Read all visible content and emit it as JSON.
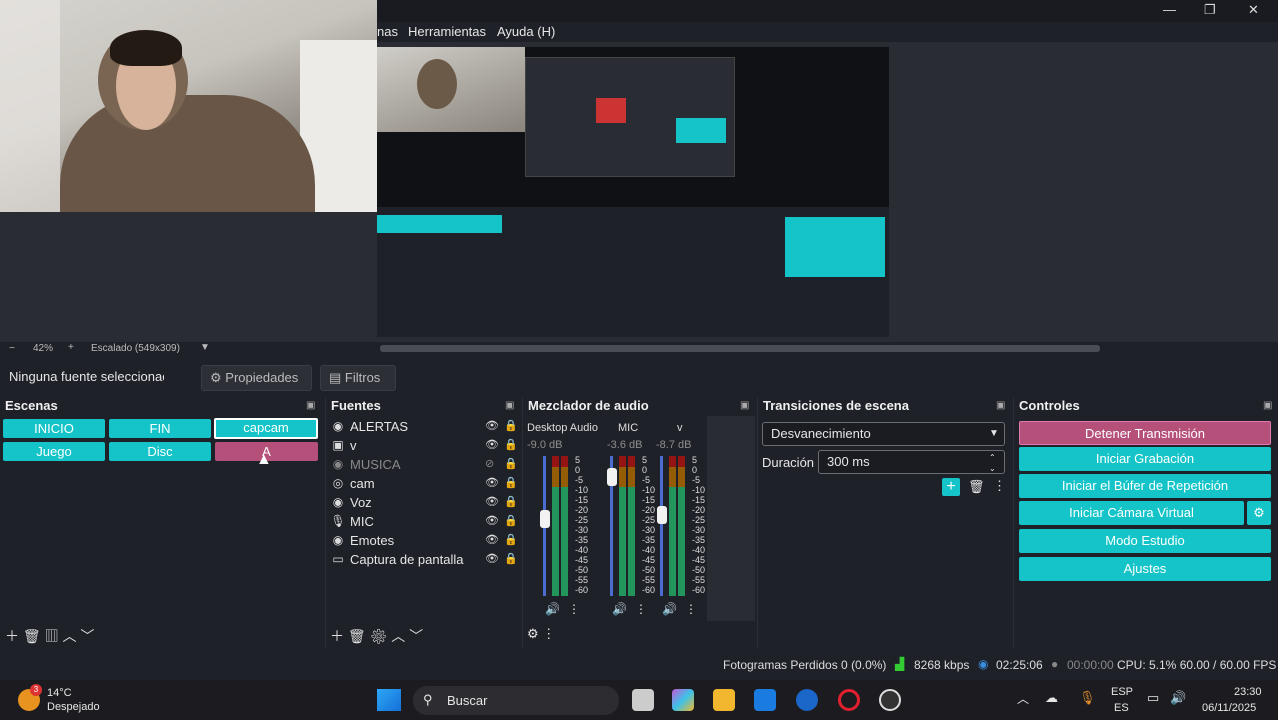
{
  "menu": {
    "partial_item": "nas",
    "items": [
      "Herramientas",
      "Ayuda (H)"
    ]
  },
  "window_controls": {
    "minimize": "—",
    "maximize": "❐",
    "close": "✕"
  },
  "preview": {
    "zoom": "42%",
    "scaling": "Escalado (549x309)"
  },
  "source_toolbar": {
    "no_source": "Ninguna fuente seleccionac",
    "properties": "Propiedades",
    "filters": "Filtros"
  },
  "scenes": {
    "title": "Escenas",
    "items": [
      {
        "label": "INICIO"
      },
      {
        "label": "FIN"
      },
      {
        "label": "capcam"
      },
      {
        "label": "Juego"
      },
      {
        "label": "Disc"
      },
      {
        "label": "A"
      }
    ]
  },
  "sources": {
    "title": "Fuentes",
    "items": [
      {
        "label": "ALERTAS",
        "icon": "globe-icon"
      },
      {
        "label": "v",
        "icon": "window-icon"
      },
      {
        "label": "MUSICA",
        "icon": "globe-icon"
      },
      {
        "label": "cam",
        "icon": "camera-icon"
      },
      {
        "label": "Voz",
        "icon": "globe-icon"
      },
      {
        "label": "MIC",
        "icon": "mic-icon"
      },
      {
        "label": "Emotes",
        "icon": "globe-icon"
      },
      {
        "label": "Captura de pantalla",
        "icon": "monitor-icon"
      }
    ]
  },
  "mixer": {
    "title": "Mezclador de audio",
    "channels": [
      {
        "name": "Desktop Audio",
        "db": "-9.0 dB",
        "level": 0.55
      },
      {
        "name": "MIC",
        "db": "-3.6 dB",
        "level": 0.85
      },
      {
        "name": "v",
        "db": "-8.7 dB",
        "level": 0.58
      }
    ],
    "scale": [
      "5",
      "0",
      "-5",
      "-10",
      "-15",
      "-20",
      "-25",
      "-30",
      "-35",
      "-40",
      "-45",
      "-50",
      "-55",
      "-60"
    ]
  },
  "transitions": {
    "title": "Transiciones de escena",
    "selected": "Desvanecimiento",
    "duration_label": "Duración",
    "duration_value": "300 ms"
  },
  "controls": {
    "title": "Controles",
    "stop_stream": "Detener Transmisión",
    "start_recording": "Iniciar Grabación",
    "replay_buffer": "Iniciar el Búfer de Repetición",
    "virtual_cam": "Iniciar Cámara Virtual",
    "studio_mode": "Modo Estudio",
    "settings": "Ajustes"
  },
  "status": {
    "dropped_frames": "Fotogramas Perdidos 0 (0.0%)",
    "bitrate": "8268 kbps",
    "stream_time": "02:25:06",
    "rec_time": "00:00:00",
    "cpu_fps": "CPU: 5.1% 60.00 / 60.00 FPS"
  },
  "taskbar": {
    "weather_temp": "14°C",
    "weather_desc": "Despejado",
    "weather_badge": "3",
    "search_placeholder": "Buscar",
    "lang_top": "ESP",
    "lang_bottom": "ES",
    "time": "23:30",
    "date": "06/11/2025"
  }
}
